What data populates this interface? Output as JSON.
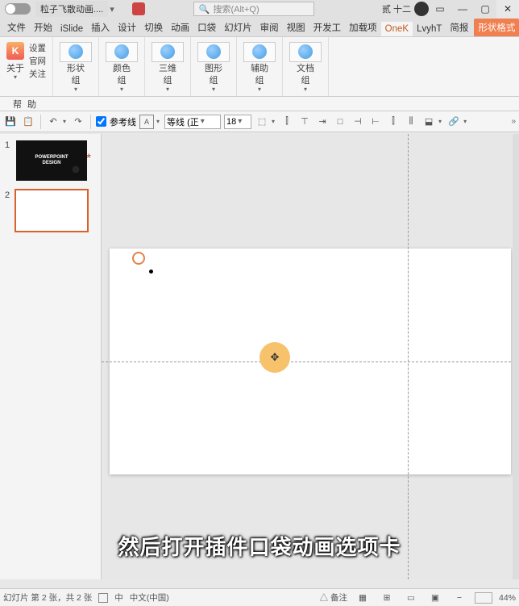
{
  "titlebar": {
    "filename": "粒子飞散动画....",
    "search_placeholder": "搜索(Alt+Q)",
    "username": "贰 十二"
  },
  "tabs": {
    "file": "文件",
    "home": "开始",
    "islide": "iSlide",
    "insert": "插入",
    "design": "设计",
    "transition": "切换",
    "animation": "动画",
    "pocket": "口袋",
    "slideshow": "幻灯片",
    "review": "审阅",
    "view": "视图",
    "developer": "开发工",
    "addins": "加载项",
    "onekey": "OneK",
    "lvyh": "LvyhT",
    "brief": "简报",
    "shape_format": "形状格式"
  },
  "ribbon": {
    "about_label": "关于",
    "about_drop": "▾",
    "set_label": "设置",
    "gw_label1": "官网",
    "gw_label2": "关注",
    "g1": "形状",
    "g2": "颜色",
    "g3": "三维",
    "g4": "图形",
    "g5": "辅助",
    "g6": "文档",
    "grp": "组",
    "drop": "▾",
    "help": "帮 助"
  },
  "toolbar": {
    "guides": "参考线",
    "font_name": "等线 (正",
    "font_size": "18"
  },
  "thumbs": {
    "n1": "1",
    "n2": "2",
    "slide1_line1": "POWERPOINT",
    "slide1_line2": "DESIGN"
  },
  "caption": "然后打开插件口袋动画选项卡",
  "status": {
    "slide_info": "幻灯片 第 2 张，共 2 张",
    "lang_short": "中",
    "lang": "中文(中国)",
    "notes": "△ 备注",
    "zoom": "44%"
  }
}
